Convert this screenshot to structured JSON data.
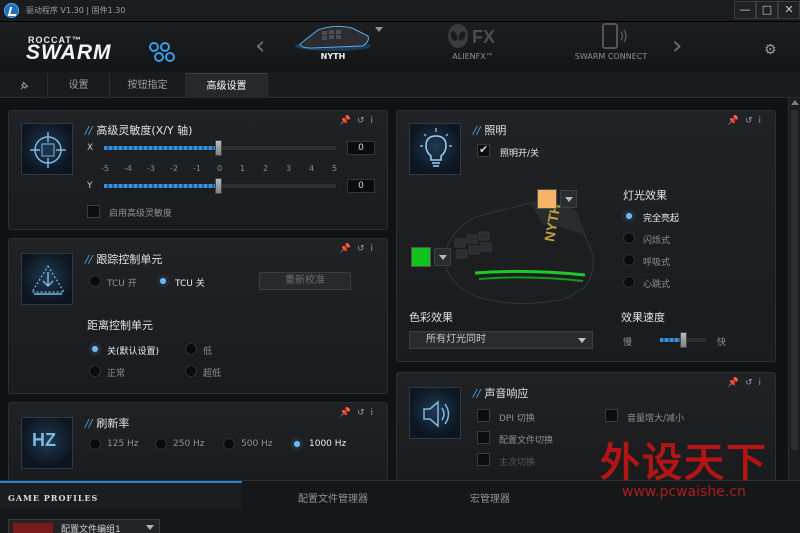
{
  "app": {
    "version_text": "驱动程序 V1.30 | 固件1.30",
    "window_buttons": {
      "minimize": "—",
      "maximize": "□",
      "close": "✕"
    }
  },
  "header": {
    "logo_top": "ROCCAT™",
    "logo_main": "SWARM",
    "devices": [
      {
        "label": "NYTH",
        "active": true
      },
      {
        "label": "ALIENFX™",
        "active": false
      },
      {
        "label": "SWARM CONNECT",
        "active": false
      }
    ],
    "nav_left": "‹",
    "nav_right": "›",
    "settings_icon": "gear-icon"
  },
  "tabs": [
    {
      "label": "设置",
      "active": false
    },
    {
      "label": "按钮指定",
      "active": false
    },
    {
      "label": "高级设置",
      "active": true
    }
  ],
  "panels": {
    "sensitivity": {
      "title": "高级灵敏度(X/Y 轴)",
      "x_label": "X",
      "y_label": "Y",
      "scale": [
        "-5",
        "-4",
        "-3",
        "-2",
        "-1",
        "0",
        "1",
        "2",
        "3",
        "4",
        "5"
      ],
      "x_value": "0",
      "y_value": "0",
      "enable_label": "启用高级灵敏度",
      "enable_checked": false
    },
    "tracking": {
      "title": "跟踪控制单元",
      "tcu_on": "TCU 开",
      "tcu_off": "TCU 关",
      "tcu_selected": "off",
      "recalibrate": "重新校准",
      "distance_title": "距离控制单元",
      "distance_options": [
        "关(默认设置)",
        "低",
        "正常",
        "超低"
      ],
      "distance_selected": 0
    },
    "polling": {
      "title": "刷新率",
      "icon_text": "HZ",
      "options": [
        "125 Hz",
        "250 Hz",
        "500 Hz",
        "1000 Hz"
      ],
      "selected": 3
    },
    "lighting": {
      "title": "照明",
      "toggle_label": "照明开/关",
      "toggle_checked": true,
      "effect_title": "灯光效果",
      "effects": [
        "完全亮起",
        "闪烁式",
        "呼吸式",
        "心跳式"
      ],
      "effect_selected": 0,
      "color_effect_title": "色彩效果",
      "color_effect_value": "所有灯光同时",
      "speed_title": "效果速度",
      "speed_slow": "慢",
      "speed_fast": "快",
      "speed_value_fraction": 0.5,
      "top_color": "#f5b36a",
      "side_color": "#14c21e"
    },
    "sound": {
      "title": "声音响应",
      "options": [
        "DPI 切换",
        "音量增大/减小",
        "配置文件切换",
        "主次切换"
      ]
    }
  },
  "bottom": {
    "game_profiles": "GAME PROFILES",
    "profile_manager": "配置文件管理器",
    "macro_manager": "宏管理器",
    "profile_name": "配置文件编组1"
  },
  "watermark": {
    "text": "外设天下",
    "url": "www.pcwaishe.cn"
  },
  "colors": {
    "accent": "#4aa3e6",
    "background": "#121314"
  }
}
